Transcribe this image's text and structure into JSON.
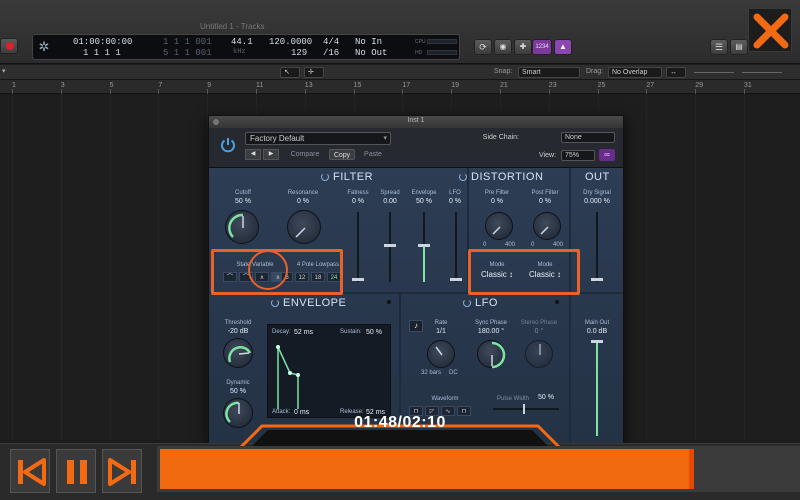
{
  "window": {
    "title": "Untitled 1 - Tracks"
  },
  "lcd": {
    "time": "01:00:00:00",
    "bars_top": "1  1  1  1",
    "bars_bottom": "1  1  1  1",
    "bars_dim_top": "1  1  1  001",
    "bars_dim_bottom": "5  1  1  001",
    "sample_rate": "44.1",
    "sample_rate_unit": "kHz",
    "tempo": "120.0000",
    "tempo_bpm": "129",
    "signature": "4/4",
    "division": "/16",
    "midi_in": "No In",
    "midi_out": "No Out",
    "cpu_label": "CPU",
    "hd_label": "HD",
    "counter_badge": "1234"
  },
  "toolbar2": {
    "snap_label": "Snap:",
    "snap_value": "Smart",
    "drag_label": "Drag:",
    "drag_value": "No Overlap"
  },
  "ruler": [
    "1",
    "3",
    "5",
    "7",
    "9",
    "11",
    "13",
    "15",
    "17",
    "19",
    "21",
    "23",
    "25",
    "27",
    "29",
    "31"
  ],
  "plugin": {
    "title": "Inst 1",
    "preset": "Factory Default",
    "compare": "Compare",
    "copy": "Copy",
    "paste": "Paste",
    "side_chain_label": "Side Chain:",
    "side_chain_value": "None",
    "view_label": "View:",
    "view_value": "75%",
    "filter": {
      "title": "FILTER",
      "cutoff_label": "Cutoff",
      "cutoff_value": "50 %",
      "resonance_label": "Resonance",
      "resonance_value": "0 %",
      "fatness_label": "Fatness",
      "fatness_value": "0 %",
      "spread_label": "Spread",
      "spread_value": "0.00",
      "envelope_label": "Envelope",
      "envelope_value": "50 %",
      "lfo_label": "LFO",
      "lfo_value": "0 %",
      "state_variable_label": "State Variable",
      "pole_lowpass_label": "4 Pole Lowpass",
      "pole_6": "6",
      "pole_12": "12",
      "pole_18": "18",
      "pole_24": "24"
    },
    "distortion": {
      "title": "DISTORTION",
      "pre_filter_label": "Pre Filter",
      "pre_filter_value": "0 %",
      "post_filter_label": "Post Filter",
      "post_filter_value": "0 %",
      "mode_label_1": "Mode",
      "mode_value_1": "Classic ↕",
      "mode_label_2": "Mode",
      "mode_value_2": "Classic ↕",
      "scale_min": "0",
      "scale_max": "400"
    },
    "out": {
      "title": "OUT",
      "dry_signal_label": "Dry Signal",
      "dry_signal_value": "0.000 %",
      "main_out_label": "Main Out",
      "main_out_value": "0.0 dB"
    },
    "envelope": {
      "title": "ENVELOPE",
      "threshold_label": "Threshold",
      "threshold_value": "-20 dB",
      "dynamic_label": "Dynamic",
      "dynamic_value": "50 %",
      "decay_label": "Decay:",
      "decay_value": "52 ms",
      "sustain_label": "Sustain:",
      "sustain_value": "50 %",
      "attack_label": "Attack:",
      "attack_value": "0 ms",
      "release_label": "Release:",
      "release_value": "52 ms"
    },
    "lfo": {
      "title": "LFO",
      "rate_label": "Rate",
      "rate_value": "1/1",
      "sync_phase_label": "Sync Phase",
      "sync_phase_value": "180.00 °",
      "stereo_phase_label": "Stereo Phase",
      "stereo_phase_value": "0 °",
      "rate_min": "32 bars",
      "rate_max": "DC",
      "waveform_label": "Waveform",
      "pulse_width_label": "Pulse Width",
      "pulse_width_value": "50 %"
    }
  },
  "player": {
    "time": "01:48/02:10",
    "progress": 0.83
  }
}
